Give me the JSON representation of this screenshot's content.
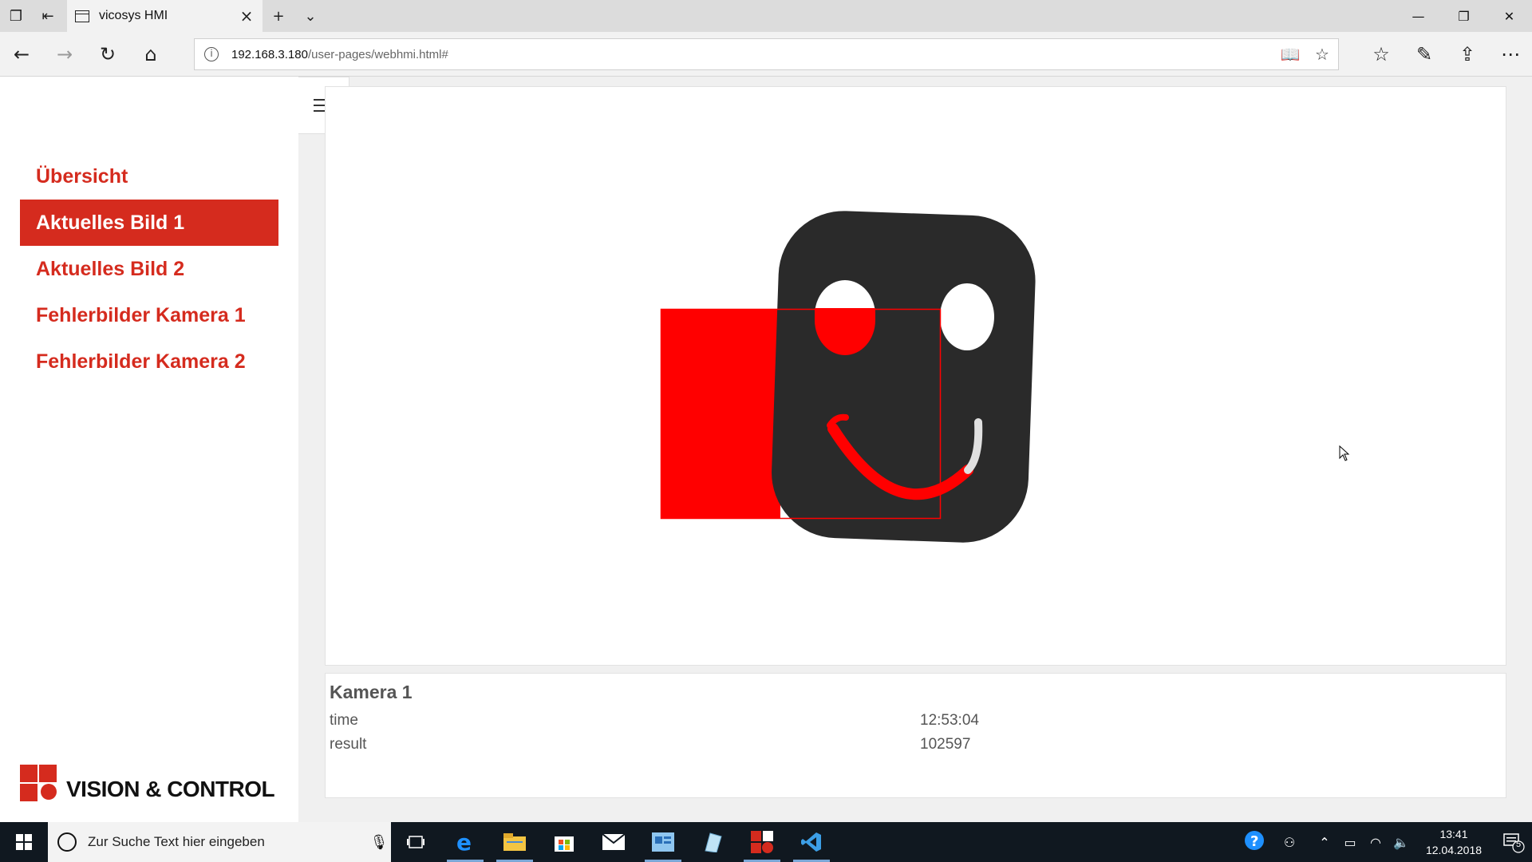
{
  "browser": {
    "tab_title": "vicosys HMI",
    "url_host": "192.168.3.180",
    "url_path": "/user-pages/webhmi.html#"
  },
  "sidebar": {
    "items": [
      {
        "label": "Übersicht",
        "active": false
      },
      {
        "label": "Aktuelles Bild 1",
        "active": true
      },
      {
        "label": "Aktuelles Bild 2",
        "active": false
      },
      {
        "label": "Fehlerbilder Kamera 1",
        "active": false
      },
      {
        "label": "Fehlerbilder Kamera 2",
        "active": false
      }
    ],
    "logo_text": "VISION & CONTROL"
  },
  "camera": {
    "title": "Kamera 1",
    "rows": [
      {
        "key": "time",
        "value": "12:53:04"
      },
      {
        "key": "result",
        "value": "102597"
      }
    ]
  },
  "taskbar": {
    "search_placeholder": "Zur Suche Text hier eingeben",
    "time": "13:41",
    "date": "12.04.2018",
    "notification_count": "5"
  },
  "colors": {
    "brand_red": "#d52b1e",
    "overlay_red": "#ff0000",
    "taskbar_bg": "#101820"
  }
}
